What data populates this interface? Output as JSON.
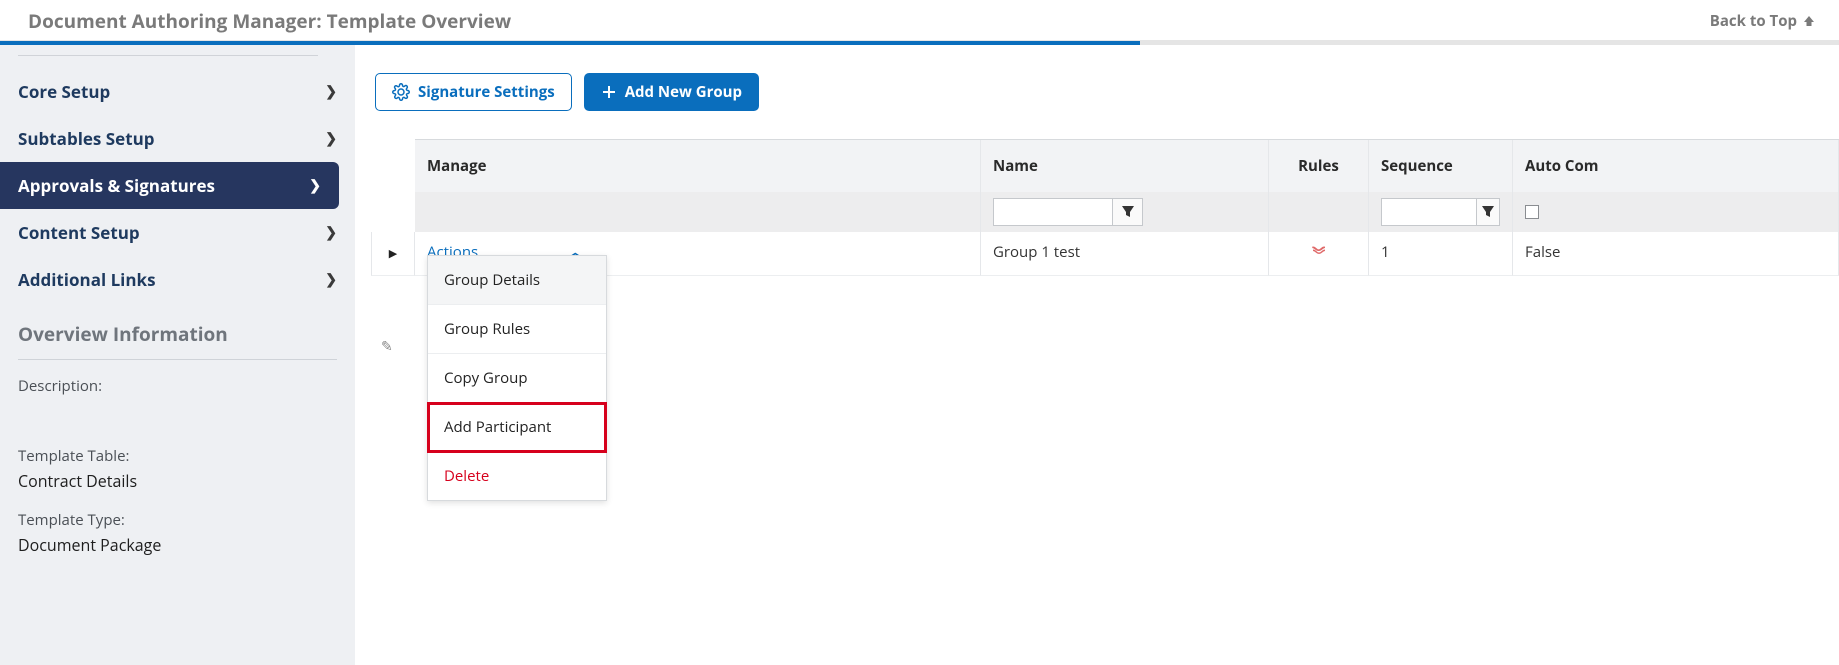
{
  "header": {
    "title": "Document Authoring Manager: Template Overview",
    "back_to_top": "Back to Top"
  },
  "sidebar": {
    "items": [
      {
        "label": "Core Setup"
      },
      {
        "label": "Subtables Setup"
      },
      {
        "label": "Approvals & Signatures"
      },
      {
        "label": "Content Setup"
      },
      {
        "label": "Additional Links"
      }
    ],
    "overview_heading": "Overview Information",
    "description_label": "Description:",
    "description_value": "",
    "template_table_label": "Template Table:",
    "template_table_value": "Contract Details",
    "template_type_label": "Template Type:",
    "template_type_value": "Document Package"
  },
  "toolbar": {
    "signature_settings": "Signature Settings",
    "add_new_group": "Add New Group"
  },
  "table": {
    "columns": {
      "manage": "Manage",
      "name": "Name",
      "rules": "Rules",
      "sequence": "Sequence",
      "auto": "Auto Com"
    },
    "row": {
      "actions_label": "Actions",
      "name": "Group 1 test",
      "sequence": "1",
      "auto": "False"
    }
  },
  "dropdown": {
    "group_details": "Group Details",
    "group_rules": "Group Rules",
    "copy_group": "Copy Group",
    "add_participant": "Add Participant",
    "delete": "Delete"
  }
}
